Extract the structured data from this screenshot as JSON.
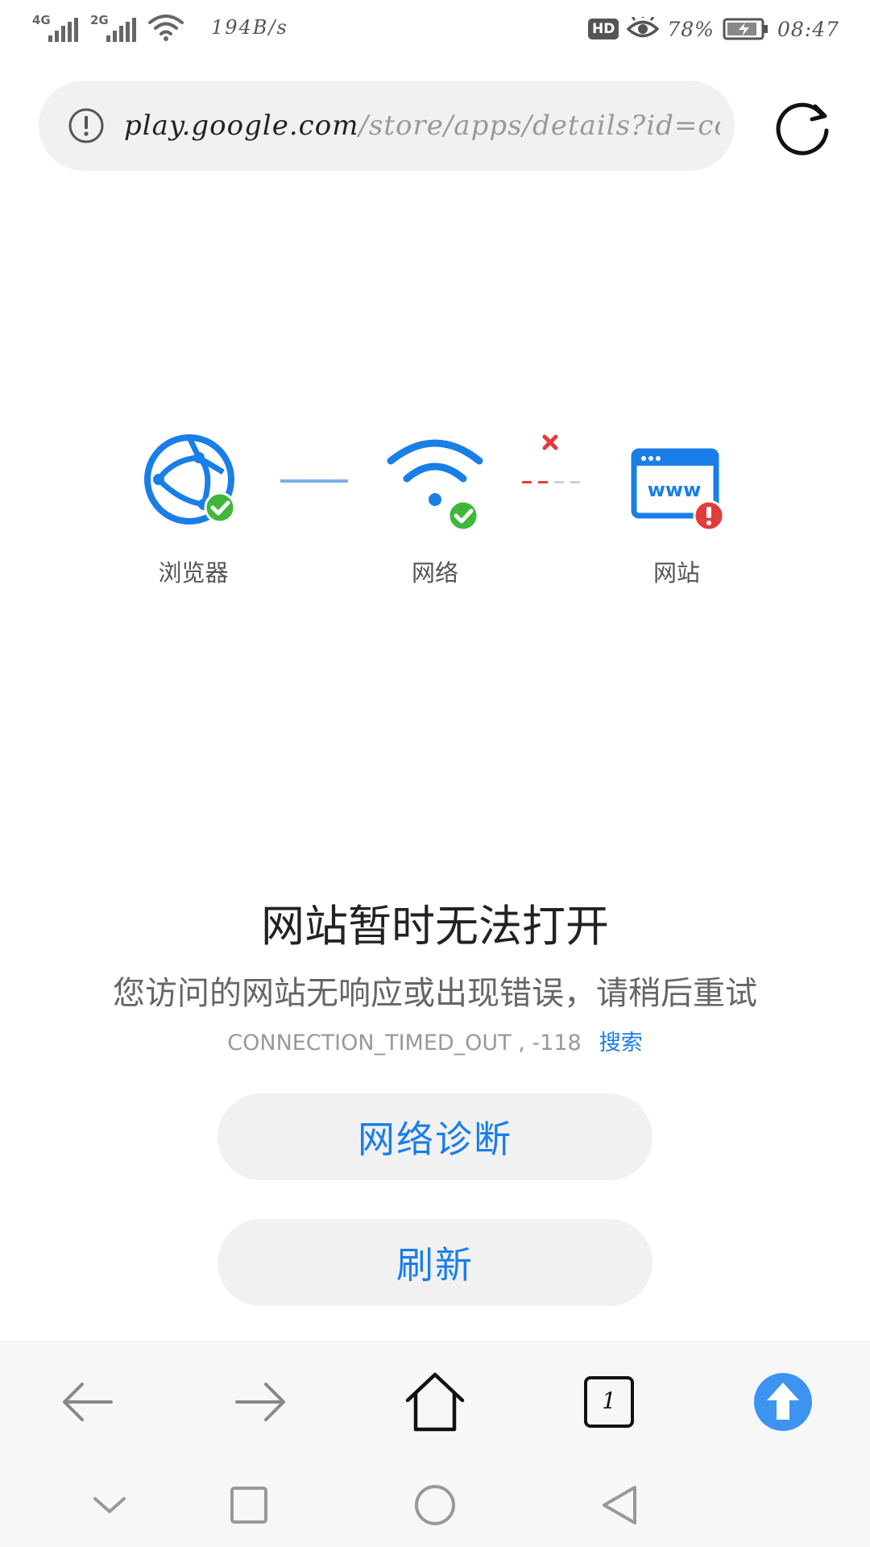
{
  "status_bar": {
    "sim1_type": "4G",
    "sim2_type": "2G",
    "net_speed": "194B/s",
    "hd_badge": "HD",
    "battery": "78%",
    "time": "08:47",
    "icons": [
      "signal-icon",
      "signal-icon",
      "wifi-icon",
      "hd-icon",
      "eye-icon",
      "battery-charging-icon"
    ]
  },
  "url_bar": {
    "host": "play.google.com",
    "path": "/store/apps/details?id=com",
    "info_icon": "info-circle-icon",
    "reload_icon": "reload-icon"
  },
  "diagram": {
    "nodes": [
      {
        "label": "浏览器",
        "icon": "browser-globe-icon",
        "status": "ok"
      },
      {
        "label": "网络",
        "icon": "wifi-icon",
        "status": "ok"
      },
      {
        "label": "网站",
        "icon": "website-www-icon",
        "status": "error"
      }
    ],
    "broken_link_icon": "x-icon"
  },
  "message": {
    "title": "网站暂时无法打开",
    "subtitle": "您访问的网站无响应或出现错误，请稍后重试",
    "error_code": "CONNECTION_TIMED_OUT , -118",
    "search_link": "搜索"
  },
  "buttons": {
    "diagnose": "网络诊断",
    "refresh": "刷新"
  },
  "toolbar": {
    "tab_count": "1",
    "icons": [
      "back-arrow-icon",
      "forward-arrow-icon",
      "home-icon",
      "tabs-icon",
      "upload-icon"
    ]
  },
  "nav_bar": {
    "icons": [
      "collapse-chevron-icon",
      "recents-square-icon",
      "home-circle-icon",
      "back-triangle-icon"
    ]
  },
  "colors": {
    "accent": "#1a7ee8",
    "ok": "#3db83a",
    "error": "#e23c3c",
    "upload": "#3d93f0"
  }
}
